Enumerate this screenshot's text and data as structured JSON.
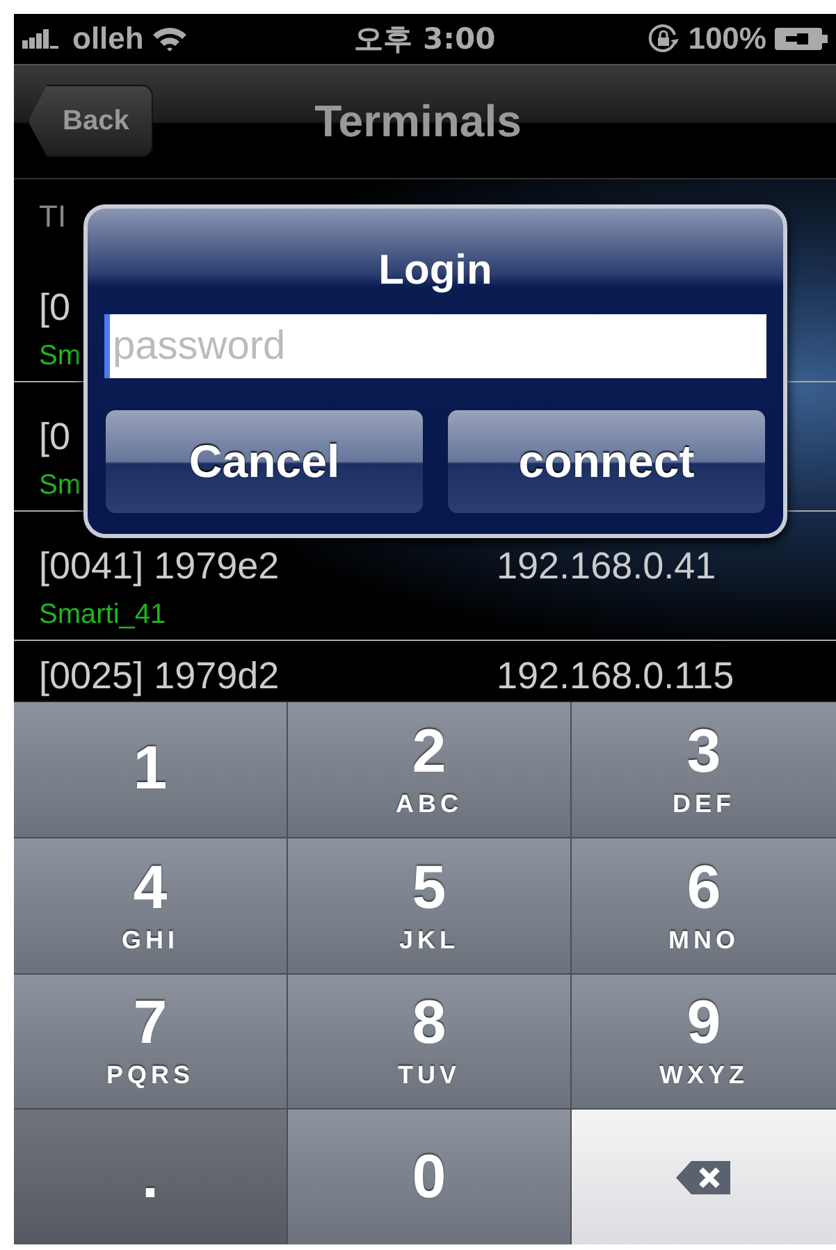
{
  "status_bar": {
    "carrier": "olleh",
    "time": "오후 3:00",
    "battery": "100%"
  },
  "nav_bar": {
    "back": "Back",
    "title": "Terminals"
  },
  "table": {
    "columns": [
      "TI"
    ],
    "rows": [
      {
        "id": "[0",
        "name": "Sm"
      },
      {
        "id": "[0",
        "name": "Sm"
      },
      {
        "id": "[0041] 1979e2",
        "ip": "192.168.0.41",
        "name": "Smarti_41"
      },
      {
        "id": "[0025] 1979d2",
        "ip": "192.168.0.115"
      }
    ]
  },
  "alert": {
    "title": "Login",
    "field": {
      "placeholder": "password"
    },
    "buttons": [
      "Cancel",
      "connect"
    ]
  },
  "keypad": [
    {
      "kind": "digit",
      "digit": "1"
    },
    {
      "kind": "digit",
      "digit": "2",
      "letters": "ABC"
    },
    {
      "kind": "digit",
      "digit": "3",
      "letters": "DEF"
    },
    {
      "kind": "digit",
      "digit": "4",
      "letters": "GHI"
    },
    {
      "kind": "digit",
      "digit": "5",
      "letters": "JKL"
    },
    {
      "kind": "digit",
      "digit": "6",
      "letters": "MNO"
    },
    {
      "kind": "digit",
      "digit": "7",
      "letters": "PQRS"
    },
    {
      "kind": "digit",
      "digit": "8",
      "letters": "TUV"
    },
    {
      "kind": "digit",
      "digit": "9",
      "letters": "WXYZ"
    },
    {
      "kind": "symbol",
      "digit": "."
    },
    {
      "kind": "digit",
      "digit": "0"
    },
    {
      "kind": "delete"
    }
  ]
}
